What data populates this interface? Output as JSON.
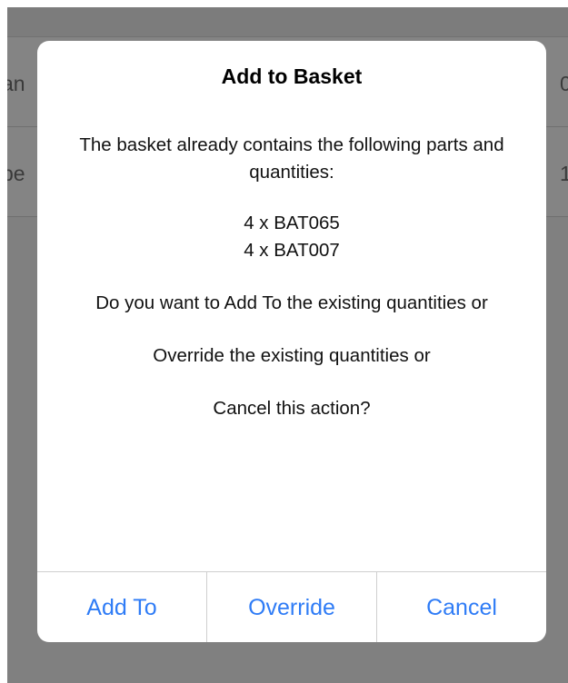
{
  "background_table": {
    "rows": [
      {
        "left_text": "an",
        "right_text": "0"
      },
      {
        "left_text": "pe",
        "right_text": "1"
      }
    ]
  },
  "dialog": {
    "title": "Add to Basket",
    "intro": "The basket already contains the following parts and quantities:",
    "items": [
      "4 x BAT065",
      "4 x BAT007"
    ],
    "question_add": "Do you want to Add To the existing quantities or",
    "question_override": "Override the existing quantities or",
    "question_cancel": "Cancel this action?",
    "buttons": {
      "add_to": "Add To",
      "override": "Override",
      "cancel": "Cancel"
    }
  },
  "colors": {
    "accent": "#2f7cf6",
    "overlay": "#808080"
  }
}
